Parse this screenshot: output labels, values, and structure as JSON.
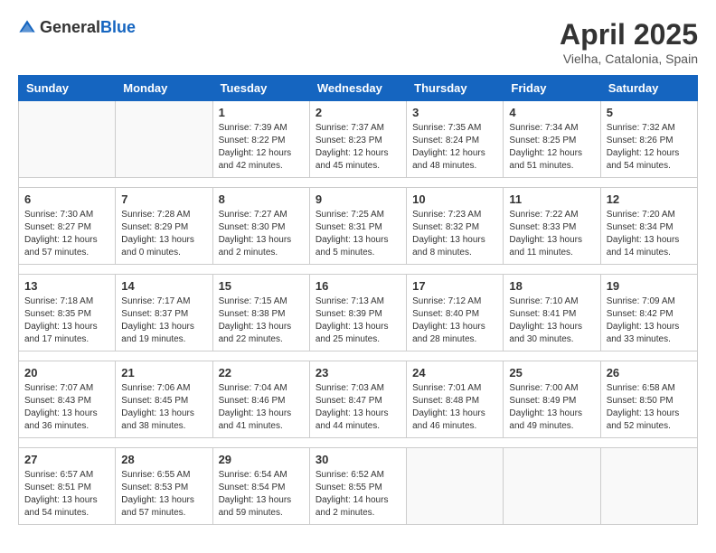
{
  "header": {
    "logo_general": "General",
    "logo_blue": "Blue",
    "title": "April 2025",
    "location": "Vielha, Catalonia, Spain"
  },
  "days_of_week": [
    "Sunday",
    "Monday",
    "Tuesday",
    "Wednesday",
    "Thursday",
    "Friday",
    "Saturday"
  ],
  "weeks": [
    [
      {
        "day": "",
        "info": ""
      },
      {
        "day": "",
        "info": ""
      },
      {
        "day": "1",
        "info": "Sunrise: 7:39 AM\nSunset: 8:22 PM\nDaylight: 12 hours and 42 minutes."
      },
      {
        "day": "2",
        "info": "Sunrise: 7:37 AM\nSunset: 8:23 PM\nDaylight: 12 hours and 45 minutes."
      },
      {
        "day": "3",
        "info": "Sunrise: 7:35 AM\nSunset: 8:24 PM\nDaylight: 12 hours and 48 minutes."
      },
      {
        "day": "4",
        "info": "Sunrise: 7:34 AM\nSunset: 8:25 PM\nDaylight: 12 hours and 51 minutes."
      },
      {
        "day": "5",
        "info": "Sunrise: 7:32 AM\nSunset: 8:26 PM\nDaylight: 12 hours and 54 minutes."
      }
    ],
    [
      {
        "day": "6",
        "info": "Sunrise: 7:30 AM\nSunset: 8:27 PM\nDaylight: 12 hours and 57 minutes."
      },
      {
        "day": "7",
        "info": "Sunrise: 7:28 AM\nSunset: 8:29 PM\nDaylight: 13 hours and 0 minutes."
      },
      {
        "day": "8",
        "info": "Sunrise: 7:27 AM\nSunset: 8:30 PM\nDaylight: 13 hours and 2 minutes."
      },
      {
        "day": "9",
        "info": "Sunrise: 7:25 AM\nSunset: 8:31 PM\nDaylight: 13 hours and 5 minutes."
      },
      {
        "day": "10",
        "info": "Sunrise: 7:23 AM\nSunset: 8:32 PM\nDaylight: 13 hours and 8 minutes."
      },
      {
        "day": "11",
        "info": "Sunrise: 7:22 AM\nSunset: 8:33 PM\nDaylight: 13 hours and 11 minutes."
      },
      {
        "day": "12",
        "info": "Sunrise: 7:20 AM\nSunset: 8:34 PM\nDaylight: 13 hours and 14 minutes."
      }
    ],
    [
      {
        "day": "13",
        "info": "Sunrise: 7:18 AM\nSunset: 8:35 PM\nDaylight: 13 hours and 17 minutes."
      },
      {
        "day": "14",
        "info": "Sunrise: 7:17 AM\nSunset: 8:37 PM\nDaylight: 13 hours and 19 minutes."
      },
      {
        "day": "15",
        "info": "Sunrise: 7:15 AM\nSunset: 8:38 PM\nDaylight: 13 hours and 22 minutes."
      },
      {
        "day": "16",
        "info": "Sunrise: 7:13 AM\nSunset: 8:39 PM\nDaylight: 13 hours and 25 minutes."
      },
      {
        "day": "17",
        "info": "Sunrise: 7:12 AM\nSunset: 8:40 PM\nDaylight: 13 hours and 28 minutes."
      },
      {
        "day": "18",
        "info": "Sunrise: 7:10 AM\nSunset: 8:41 PM\nDaylight: 13 hours and 30 minutes."
      },
      {
        "day": "19",
        "info": "Sunrise: 7:09 AM\nSunset: 8:42 PM\nDaylight: 13 hours and 33 minutes."
      }
    ],
    [
      {
        "day": "20",
        "info": "Sunrise: 7:07 AM\nSunset: 8:43 PM\nDaylight: 13 hours and 36 minutes."
      },
      {
        "day": "21",
        "info": "Sunrise: 7:06 AM\nSunset: 8:45 PM\nDaylight: 13 hours and 38 minutes."
      },
      {
        "day": "22",
        "info": "Sunrise: 7:04 AM\nSunset: 8:46 PM\nDaylight: 13 hours and 41 minutes."
      },
      {
        "day": "23",
        "info": "Sunrise: 7:03 AM\nSunset: 8:47 PM\nDaylight: 13 hours and 44 minutes."
      },
      {
        "day": "24",
        "info": "Sunrise: 7:01 AM\nSunset: 8:48 PM\nDaylight: 13 hours and 46 minutes."
      },
      {
        "day": "25",
        "info": "Sunrise: 7:00 AM\nSunset: 8:49 PM\nDaylight: 13 hours and 49 minutes."
      },
      {
        "day": "26",
        "info": "Sunrise: 6:58 AM\nSunset: 8:50 PM\nDaylight: 13 hours and 52 minutes."
      }
    ],
    [
      {
        "day": "27",
        "info": "Sunrise: 6:57 AM\nSunset: 8:51 PM\nDaylight: 13 hours and 54 minutes."
      },
      {
        "day": "28",
        "info": "Sunrise: 6:55 AM\nSunset: 8:53 PM\nDaylight: 13 hours and 57 minutes."
      },
      {
        "day": "29",
        "info": "Sunrise: 6:54 AM\nSunset: 8:54 PM\nDaylight: 13 hours and 59 minutes."
      },
      {
        "day": "30",
        "info": "Sunrise: 6:52 AM\nSunset: 8:55 PM\nDaylight: 14 hours and 2 minutes."
      },
      {
        "day": "",
        "info": ""
      },
      {
        "day": "",
        "info": ""
      },
      {
        "day": "",
        "info": ""
      }
    ]
  ]
}
